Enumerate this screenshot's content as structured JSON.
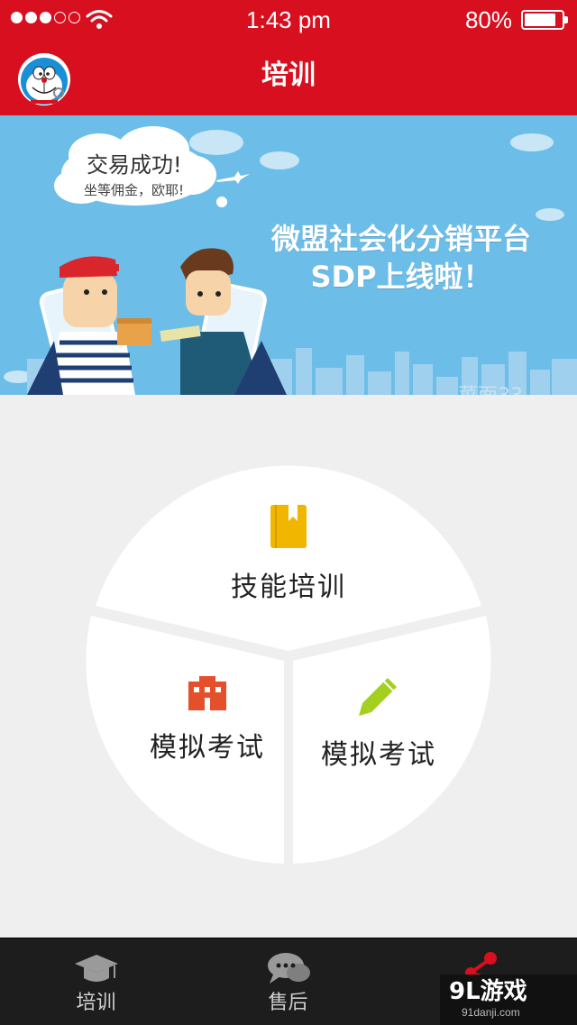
{
  "status_bar": {
    "time": "1:43 pm",
    "battery": "80%",
    "battery_level": 0.8,
    "signal_bars_filled": 3,
    "signal_bars_total": 5
  },
  "header": {
    "title": "培训",
    "avatar_icon": "doraemon-avatar-icon"
  },
  "banner": {
    "bubble_title": "交易成功!",
    "bubble_sub": "坐等佣金，欧耶!",
    "slogan_line1": "微盟社会化分销平台",
    "slogan_line2": "SDP上线啦！"
  },
  "menu": {
    "top": {
      "label": "技能培训",
      "icon": "book-icon",
      "icon_color": "#f1b600"
    },
    "left": {
      "label": "模拟考试",
      "icon": "building-icon",
      "icon_color": "#e4502c"
    },
    "right": {
      "label": "模拟考试",
      "icon": "pencil-icon",
      "icon_color": "#a3d01e"
    }
  },
  "tabbar": {
    "tabs": [
      {
        "label": "培训",
        "icon": "graduation-cap-icon"
      },
      {
        "label": "售后",
        "icon": "chat-bubbles-icon"
      },
      {
        "label": "",
        "icon": "share-icon",
        "active": true
      }
    ],
    "accent_color": "#d70f1e"
  },
  "watermark": {
    "main": "9L游戏",
    "sub": "91danji.com"
  },
  "colors": {
    "brand_red": "#d70f1e",
    "background": "#efefef",
    "tabbar": "#1d1d1d"
  }
}
